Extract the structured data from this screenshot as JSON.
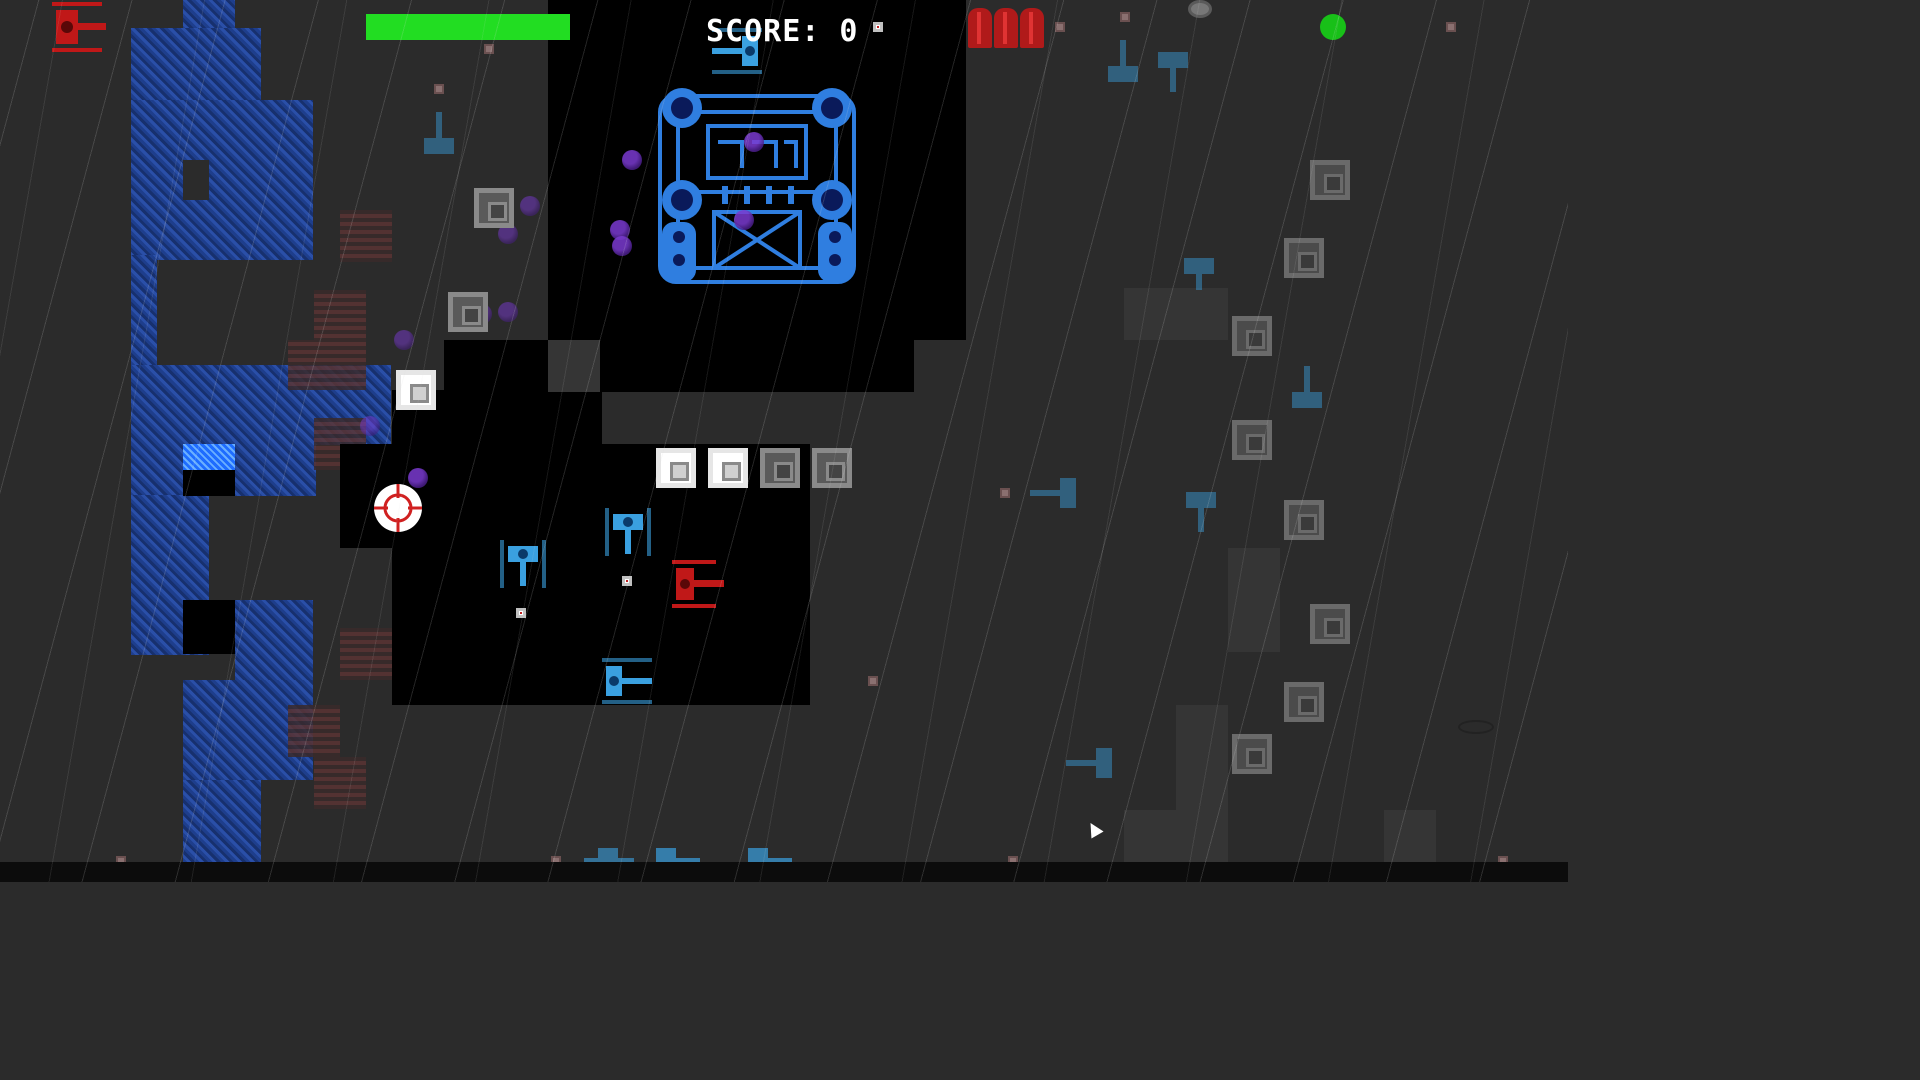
{
  "hud": {
    "score_label": "SCORE: 0",
    "health_fraction": 1.0,
    "ammo_count": 3,
    "status_light_color": "#18c018"
  },
  "colors": {
    "health": "#22dd22",
    "player_tank": "#c01818",
    "enemy_tank": "#3aa0e0",
    "boss": "#2f6fd0",
    "water": "#2a4fa8",
    "background": "#2b2b2b"
  },
  "entities": {
    "player": {
      "icon": "red-tank-icon"
    },
    "boss": {
      "icon": "fortress-boss-icon"
    },
    "crosshair": {
      "icon": "crosshair-icon"
    }
  }
}
